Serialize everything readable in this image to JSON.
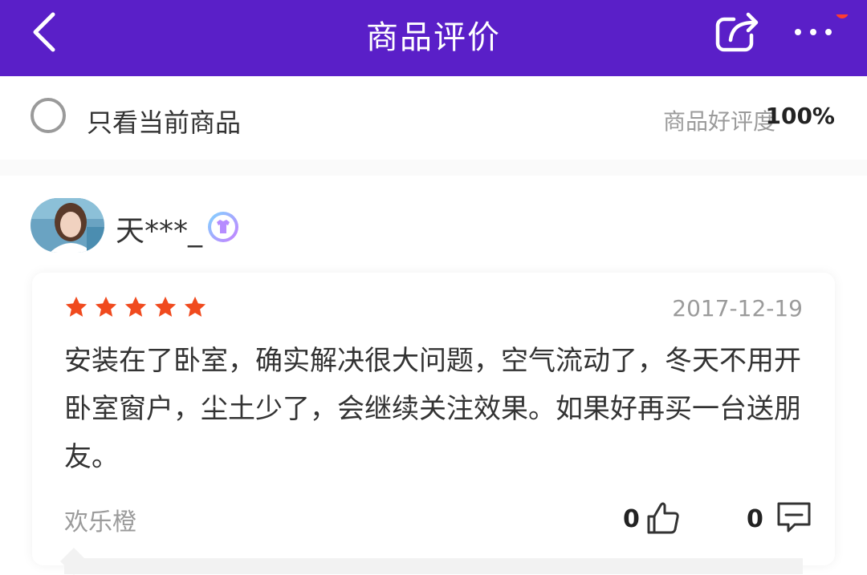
{
  "header": {
    "title": "商品评价",
    "back_icon": "chevron-left-icon",
    "share_icon": "share-icon",
    "more_icon": "more-dots-icon",
    "notification_dot_color": "#ff3b30",
    "background_color": "#5a1fc8"
  },
  "filter": {
    "only_current_label": "只看当前商品",
    "only_current_checked": false,
    "rating_label": "商品好评度",
    "rating_value": "100%"
  },
  "review": {
    "username": "天***_",
    "badge_icon": "member-badge-icon",
    "stars": 5,
    "star_color": "#f04a1e",
    "date": "2017-12-19",
    "text": "安装在了卧室，确实解决很大问题，空气流动了，冬天不用开卧室窗户，尘土少了，会继续关注效果。如果好再买一台送朋友。",
    "store_name": "欢乐橙",
    "likes": "0",
    "comments": "0"
  }
}
